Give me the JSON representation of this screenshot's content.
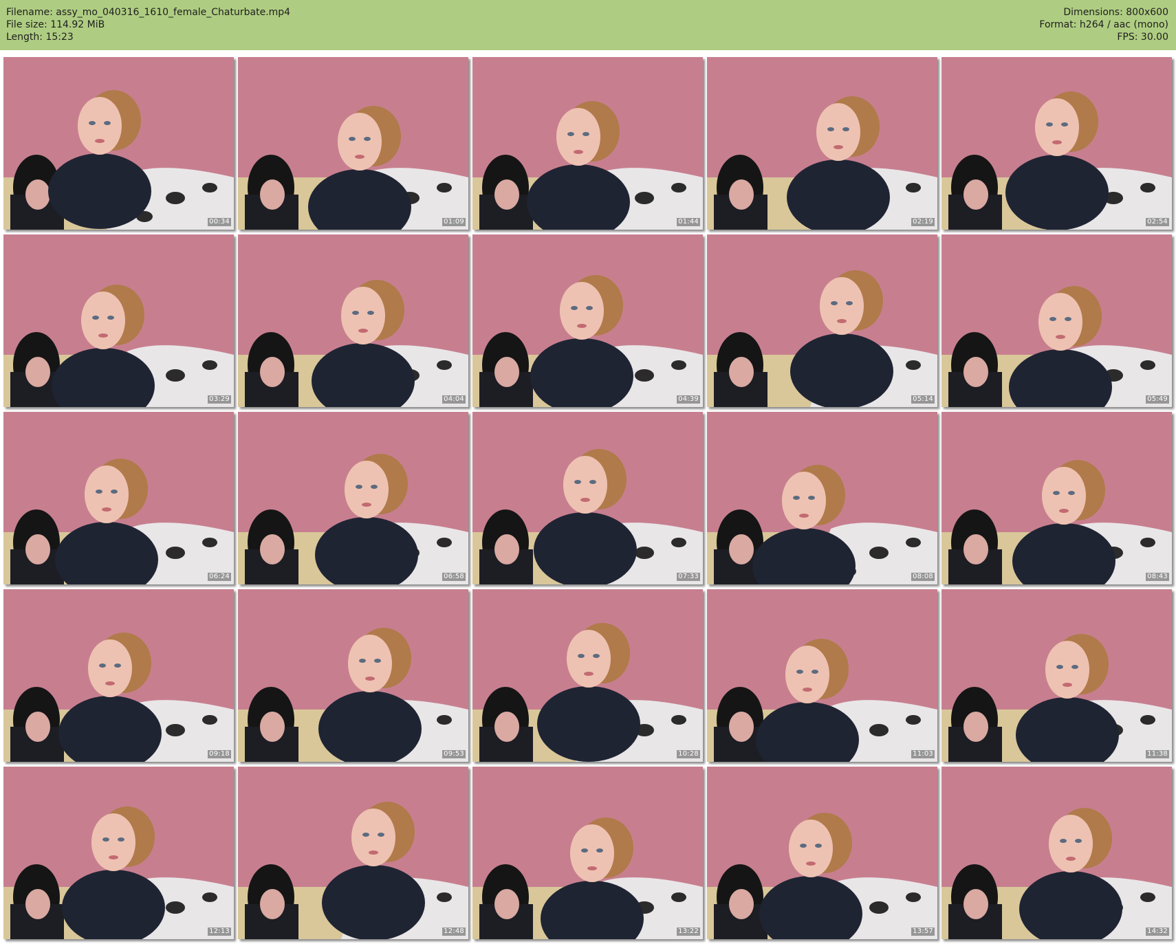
{
  "header": {
    "filename_line": "Filename: assy_mo_040316_1610_female_Chaturbate.mp4",
    "filesize_line": "File size: 114.92 MiB",
    "length_line": "Length: 15:23",
    "dimensions_line": "Dimensions: 800x600",
    "format_line": "Format: h264 / aac (mono)",
    "fps_line": "FPS: 30.00"
  },
  "colors": {
    "header_bg": "#afcd82",
    "wall": "#c77f8f",
    "sofa": "#d9c79a"
  },
  "thumbnails": [
    {
      "time": "00:34",
      "icon": "video-frame-thumbnail"
    },
    {
      "time": "01:09",
      "icon": "video-frame-thumbnail"
    },
    {
      "time": "01:44",
      "icon": "video-frame-thumbnail"
    },
    {
      "time": "02:19",
      "icon": "video-frame-thumbnail"
    },
    {
      "time": "02:54",
      "icon": "video-frame-thumbnail"
    },
    {
      "time": "03:29",
      "icon": "video-frame-thumbnail"
    },
    {
      "time": "04:04",
      "icon": "video-frame-thumbnail"
    },
    {
      "time": "04:39",
      "icon": "video-frame-thumbnail"
    },
    {
      "time": "05:14",
      "icon": "video-frame-thumbnail"
    },
    {
      "time": "05:49",
      "icon": "video-frame-thumbnail"
    },
    {
      "time": "06:24",
      "icon": "video-frame-thumbnail"
    },
    {
      "time": "06:58",
      "icon": "video-frame-thumbnail"
    },
    {
      "time": "07:33",
      "icon": "video-frame-thumbnail"
    },
    {
      "time": "08:08",
      "icon": "video-frame-thumbnail"
    },
    {
      "time": "08:43",
      "icon": "video-frame-thumbnail"
    },
    {
      "time": "09:18",
      "icon": "video-frame-thumbnail"
    },
    {
      "time": "09:53",
      "icon": "video-frame-thumbnail"
    },
    {
      "time": "10:28",
      "icon": "video-frame-thumbnail"
    },
    {
      "time": "11:03",
      "icon": "video-frame-thumbnail"
    },
    {
      "time": "11:38",
      "icon": "video-frame-thumbnail"
    },
    {
      "time": "12:13",
      "icon": "video-frame-thumbnail"
    },
    {
      "time": "12:48",
      "icon": "video-frame-thumbnail"
    },
    {
      "time": "13:22",
      "icon": "video-frame-thumbnail"
    },
    {
      "time": "13:57",
      "icon": "video-frame-thumbnail"
    },
    {
      "time": "14:32",
      "icon": "video-frame-thumbnail"
    }
  ]
}
